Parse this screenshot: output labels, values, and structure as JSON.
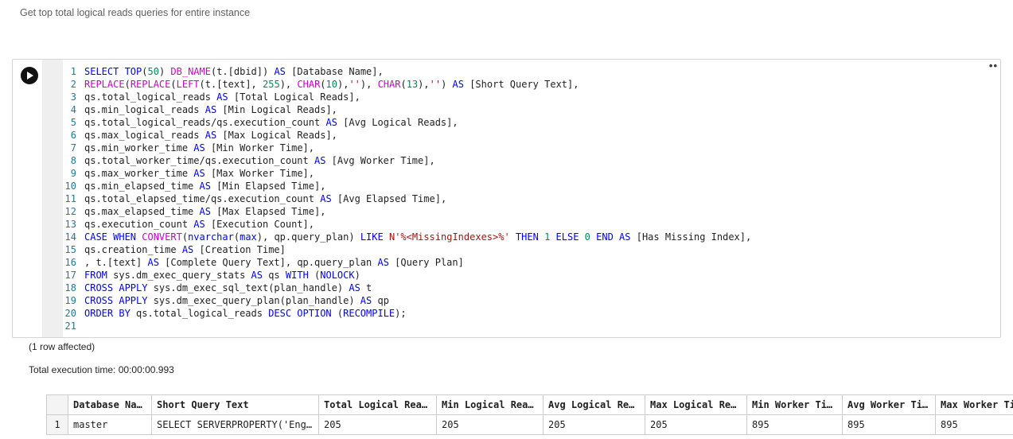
{
  "page": {
    "title": "Get top total logical reads queries for entire instance"
  },
  "cell": {
    "more_label": "••",
    "lines": [
      [
        [
          "k",
          "SELECT TOP"
        ],
        [
          "p",
          "("
        ],
        [
          "n",
          "50"
        ],
        [
          "p",
          ") "
        ],
        [
          "f",
          "DB_NAME"
        ],
        [
          "p",
          "(t.[dbid]) "
        ],
        [
          "k",
          "AS"
        ],
        [
          "p",
          " [Database Name],"
        ]
      ],
      [
        [
          "f",
          "REPLACE"
        ],
        [
          "p",
          "("
        ],
        [
          "f",
          "REPLACE"
        ],
        [
          "p",
          "("
        ],
        [
          "f",
          "LEFT"
        ],
        [
          "p",
          "(t.[text], "
        ],
        [
          "n",
          "255"
        ],
        [
          "p",
          "), "
        ],
        [
          "f",
          "CHAR"
        ],
        [
          "p",
          "("
        ],
        [
          "n",
          "10"
        ],
        [
          "p",
          "),"
        ],
        [
          "s",
          "''"
        ],
        [
          "p",
          "), "
        ],
        [
          "f",
          "CHAR"
        ],
        [
          "p",
          "("
        ],
        [
          "n",
          "13"
        ],
        [
          "p",
          "),"
        ],
        [
          "s",
          "''"
        ],
        [
          "p",
          ") "
        ],
        [
          "k",
          "AS"
        ],
        [
          "p",
          " [Short Query Text],"
        ]
      ],
      [
        [
          "p",
          "qs.total_logical_reads "
        ],
        [
          "k",
          "AS"
        ],
        [
          "p",
          " [Total Logical Reads],"
        ]
      ],
      [
        [
          "p",
          "qs.min_logical_reads "
        ],
        [
          "k",
          "AS"
        ],
        [
          "p",
          " [Min Logical Reads],"
        ]
      ],
      [
        [
          "p",
          "qs.total_logical_reads/qs.execution_count "
        ],
        [
          "k",
          "AS"
        ],
        [
          "p",
          " [Avg Logical Reads],"
        ]
      ],
      [
        [
          "p",
          "qs.max_logical_reads "
        ],
        [
          "k",
          "AS"
        ],
        [
          "p",
          " [Max Logical Reads],"
        ]
      ],
      [
        [
          "p",
          "qs.min_worker_time "
        ],
        [
          "k",
          "AS"
        ],
        [
          "p",
          " [Min Worker Time],"
        ]
      ],
      [
        [
          "p",
          "qs.total_worker_time/qs.execution_count "
        ],
        [
          "k",
          "AS"
        ],
        [
          "p",
          " [Avg Worker Time],"
        ]
      ],
      [
        [
          "p",
          "qs.max_worker_time "
        ],
        [
          "k",
          "AS"
        ],
        [
          "p",
          " [Max Worker Time],"
        ]
      ],
      [
        [
          "p",
          "qs.min_elapsed_time "
        ],
        [
          "k",
          "AS"
        ],
        [
          "p",
          " [Min Elapsed Time],"
        ]
      ],
      [
        [
          "p",
          "qs.total_elapsed_time/qs.execution_count "
        ],
        [
          "k",
          "AS"
        ],
        [
          "p",
          " [Avg Elapsed Time],"
        ]
      ],
      [
        [
          "p",
          "qs.max_elapsed_time "
        ],
        [
          "k",
          "AS"
        ],
        [
          "p",
          " [Max Elapsed Time],"
        ]
      ],
      [
        [
          "p",
          "qs.execution_count "
        ],
        [
          "k",
          "AS"
        ],
        [
          "p",
          " [Execution Count],"
        ]
      ],
      [
        [
          "k",
          "CASE WHEN "
        ],
        [
          "f",
          "CONVERT"
        ],
        [
          "p",
          "("
        ],
        [
          "k",
          "nvarchar"
        ],
        [
          "p",
          "("
        ],
        [
          "k",
          "max"
        ],
        [
          "p",
          "), qp.query_plan) "
        ],
        [
          "k",
          "LIKE"
        ],
        [
          "p",
          " "
        ],
        [
          "s",
          "N'%<MissingIndexes>%'"
        ],
        [
          "p",
          " "
        ],
        [
          "k",
          "THEN"
        ],
        [
          "p",
          " "
        ],
        [
          "n",
          "1"
        ],
        [
          "p",
          " "
        ],
        [
          "k",
          "ELSE"
        ],
        [
          "p",
          " "
        ],
        [
          "n",
          "0"
        ],
        [
          "p",
          " "
        ],
        [
          "k",
          "END AS"
        ],
        [
          "p",
          " [Has Missing Index],"
        ]
      ],
      [
        [
          "p",
          "qs.creation_time "
        ],
        [
          "k",
          "AS"
        ],
        [
          "p",
          " [Creation Time]"
        ]
      ],
      [
        [
          "p",
          ", t.[text] "
        ],
        [
          "k",
          "AS"
        ],
        [
          "p",
          " [Complete Query Text], qp.query_plan "
        ],
        [
          "k",
          "AS"
        ],
        [
          "p",
          " [Query Plan]"
        ]
      ],
      [
        [
          "k",
          "FROM"
        ],
        [
          "p",
          " sys.dm_exec_query_stats "
        ],
        [
          "k",
          "AS"
        ],
        [
          "p",
          " qs "
        ],
        [
          "k",
          "WITH"
        ],
        [
          "p",
          " ("
        ],
        [
          "k",
          "NOLOCK"
        ],
        [
          "p",
          ")"
        ]
      ],
      [
        [
          "k",
          "CROSS APPLY"
        ],
        [
          "p",
          " sys.dm_exec_sql_text(plan_handle) "
        ],
        [
          "k",
          "AS"
        ],
        [
          "p",
          " t"
        ]
      ],
      [
        [
          "k",
          "CROSS APPLY"
        ],
        [
          "p",
          " sys.dm_exec_query_plan(plan_handle) "
        ],
        [
          "k",
          "AS"
        ],
        [
          "p",
          " qp"
        ]
      ],
      [
        [
          "k",
          "ORDER BY"
        ],
        [
          "p",
          " qs.total_logical_reads "
        ],
        [
          "k",
          "DESC OPTION"
        ],
        [
          "p",
          " ("
        ],
        [
          "k",
          "RECOMPILE"
        ],
        [
          "p",
          ");"
        ]
      ],
      []
    ]
  },
  "messages": {
    "rows_affected": "(1 row affected)",
    "execution_time": "Total execution time: 00:00:00.993"
  },
  "results": {
    "columns": [
      "Database Name",
      "Short Query Text",
      "Total Logical Reads",
      "Min Logical Reads",
      "Avg Logical Reads",
      "Max Logical Reads",
      "Min Worker Time",
      "Avg Worker Time",
      "Max Worker Time"
    ],
    "rows": [
      {
        "num": "1",
        "cells": [
          "master",
          "SELECT SERVERPROPERTY('Eng…",
          "205",
          "205",
          "205",
          "205",
          "895",
          "895",
          "895"
        ]
      }
    ]
  }
}
